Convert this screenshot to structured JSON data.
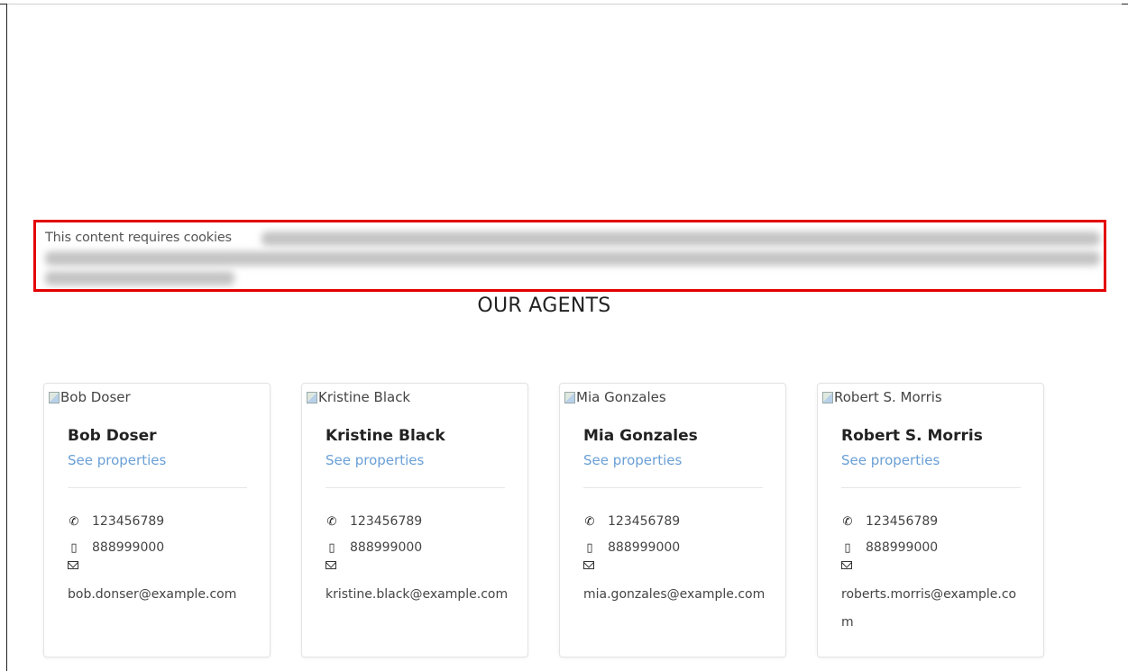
{
  "cookie_notice": {
    "text": "This content requires cookies"
  },
  "section": {
    "title": "OUR AGENTS"
  },
  "agents": [
    {
      "image_alt": "Bob Doser",
      "name": "Bob Doser",
      "link": "See properties",
      "phone": "123456789",
      "mobile": "888999000",
      "email": "bob.donser@example.com"
    },
    {
      "image_alt": "Kristine Black",
      "name": "Kristine Black",
      "link": "See properties",
      "phone": "123456789",
      "mobile": "888999000",
      "email": "kristine.black@example.com"
    },
    {
      "image_alt": "Mia Gonzales",
      "name": "Mia Gonzales",
      "link": "See properties",
      "phone": "123456789",
      "mobile": "888999000",
      "email": "mia.gonzales@example.com"
    },
    {
      "image_alt": "Robert S. Morris",
      "name": "Robert S. Morris",
      "link": "See properties",
      "phone": "123456789",
      "mobile": "888999000",
      "email": "roberts.morris@example.com"
    }
  ],
  "colors": {
    "notice_border": "#e30000",
    "link": "#6aa0d6"
  }
}
